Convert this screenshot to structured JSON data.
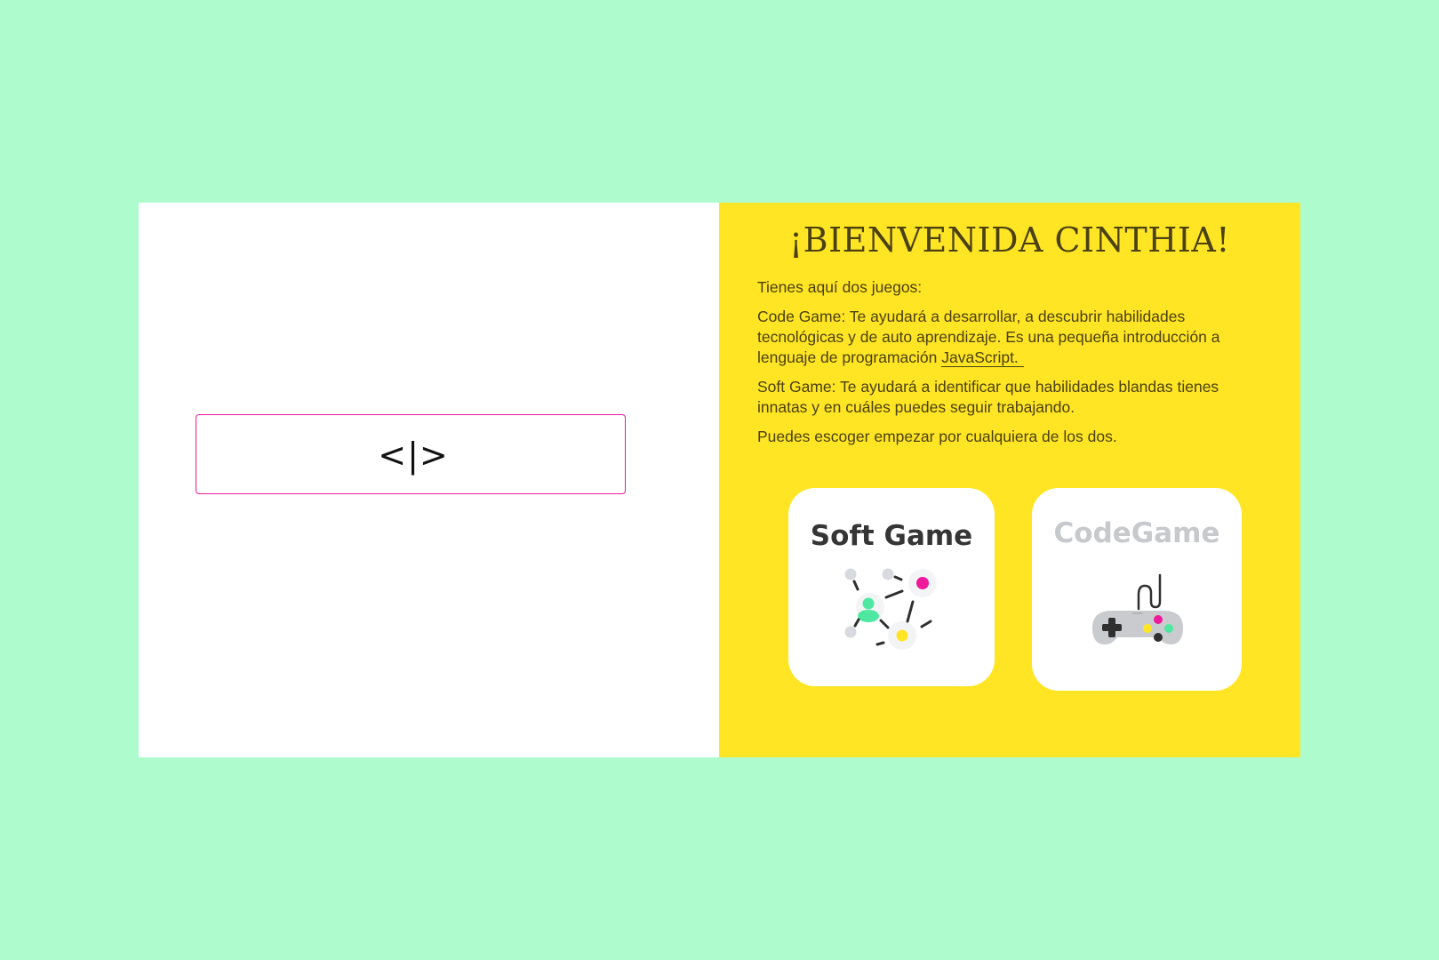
{
  "logo": {
    "text": "<|>"
  },
  "welcome": {
    "title": "¡BIENVENIDA CINTHIA!",
    "intro": "Tienes aquí dos juegos:",
    "code_game_desc": "Code Game: Te ayudará a desarrollar, a descubrir habilidades tecnológicas y de auto aprendizaje. Es una pequeña introducción a lenguaje de programación ",
    "code_game_link": "JavaScript.",
    "soft_game_desc": "Soft Game: Te ayudará a identificar que habilidades blandas tienes innatas y en cuáles puedes seguir trabajando.",
    "closing": "Puedes escoger empezar por cualquiera de los dos."
  },
  "games": {
    "soft": {
      "label": "Soft Game",
      "icon": "network-people-icon"
    },
    "code": {
      "label": "CodeGame",
      "icon": "gamepad-icon"
    }
  },
  "colors": {
    "background": "#aefbcd",
    "panel_left": "#ffffff",
    "panel_right": "#ffe524",
    "accent_magenta": "#f0189b",
    "accent_green": "#4fe8a0",
    "accent_yellow": "#ffe524",
    "text_dark": "#4b4112"
  }
}
